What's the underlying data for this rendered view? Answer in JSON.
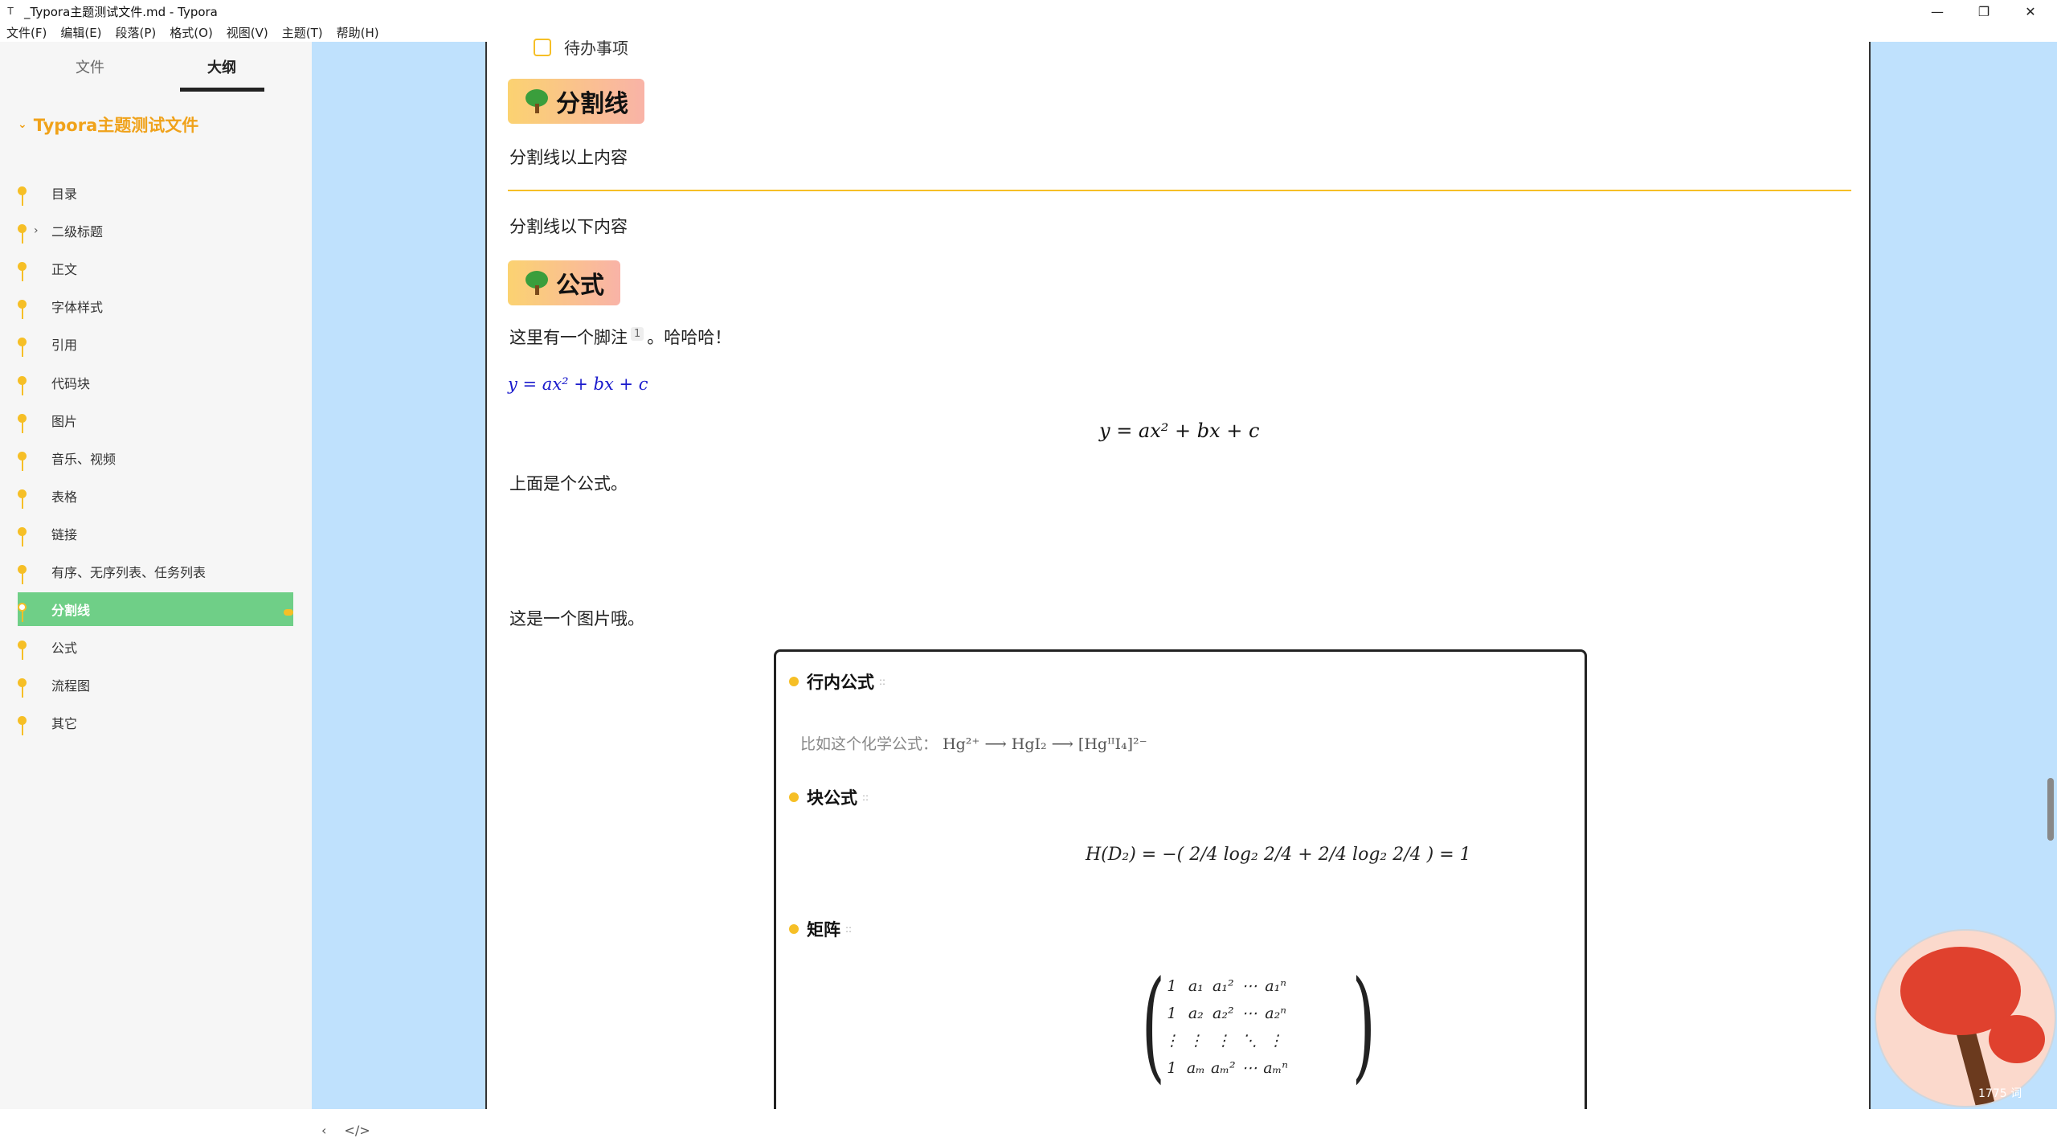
{
  "window": {
    "title": "_Typora主题测试文件.md - Typora",
    "app_icon": "T",
    "minimize": "—",
    "restore": "❐",
    "close": "✕"
  },
  "menu": [
    "文件(F)",
    "编辑(E)",
    "段落(P)",
    "格式(O)",
    "视图(V)",
    "主题(T)",
    "帮助(H)"
  ],
  "sidebar": {
    "tabs": [
      "文件",
      "大纲"
    ],
    "active_tab": "大纲",
    "root": "Typora主题测试文件",
    "items": [
      {
        "label": "目录"
      },
      {
        "label": "二级标题",
        "expandable": true
      },
      {
        "label": "正文"
      },
      {
        "label": "字体样式"
      },
      {
        "label": "引用"
      },
      {
        "label": "代码块"
      },
      {
        "label": "图片"
      },
      {
        "label": "音乐、视频"
      },
      {
        "label": "表格"
      },
      {
        "label": "链接"
      },
      {
        "label": "有序、无序列表、任务列表"
      },
      {
        "label": "分割线",
        "active": true
      },
      {
        "label": "公式"
      },
      {
        "label": "流程图"
      },
      {
        "label": "其它"
      }
    ],
    "footer": {
      "collapse": "‹",
      "source": "</>"
    }
  },
  "doc": {
    "task_item": "待办事项",
    "h_divider": "分割线",
    "above_divider": "分割线以上内容",
    "below_divider": "分割线以下内容",
    "h_formula": "公式",
    "footnote_before": "这里有一个脚注",
    "footnote_num": "1",
    "footnote_after": "。哈哈哈！",
    "inline_formula": "y = ax² + bx + c",
    "block_formula": "y = ax² + bx + c",
    "after_formula": "上面是个公式。",
    "image_caption": "这是一个图片哦。",
    "image": {
      "h_inline": "行内公式",
      "chem_prefix": "比如这个化学公式：",
      "chem_formula": "Hg²⁺ ⟶ HgI₂ ⟶ [HgᴵᴵI₄]²⁻",
      "h_block": "块公式",
      "entropy": "H(D₂) = −( 2/4 log₂ 2/4 + 2/4 log₂ 2/4 ) = 1",
      "h_matrix": "矩阵",
      "matrix": [
        [
          "1",
          "a₁",
          "a₁²",
          "⋯",
          "a₁ⁿ"
        ],
        [
          "1",
          "a₂",
          "a₂²",
          "⋯",
          "a₂ⁿ"
        ],
        [
          "⋮",
          "⋮",
          "⋮",
          "⋱",
          "⋮"
        ],
        [
          "1",
          "aₘ",
          "aₘ²",
          "⋯",
          "aₘⁿ"
        ]
      ]
    }
  },
  "status": {
    "word_count": "1775 词"
  },
  "colors": {
    "accent": "#f6bf26",
    "active_outline": "#6fcf87",
    "background_blue": "#bfe1fd",
    "heading_gradient_start": "#fbd271",
    "heading_gradient_end": "#f9b3a7"
  }
}
